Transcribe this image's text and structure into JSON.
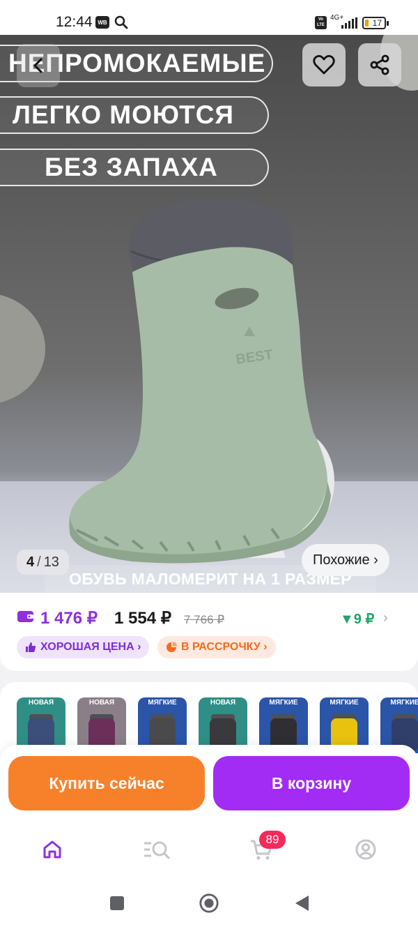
{
  "status_bar": {
    "time": "12:44",
    "wb_badge": "WB",
    "volte": "Vo LTE",
    "network": "4G+",
    "battery": "17"
  },
  "gallery": {
    "promo_lines": [
      "НЕПРОМОКАЕМЫЕ",
      "ЛЕГКО МОЮТСЯ",
      "БЕЗ ЗАПАХА"
    ],
    "bottom_caption": "ОБУВЬ МАЛОМЕРИТ НА 1 РАЗМЕР",
    "boot_brand": "BEST",
    "current_index": "4",
    "separator": "/",
    "total": "13",
    "similar_label": "Похожие ›"
  },
  "price": {
    "wallet_price": "1 476 ₽",
    "main_price": "1 554 ₽",
    "old_price": "7 766 ₽",
    "cashback": "▼9 ₽",
    "cashback_chevron": "›",
    "badges": [
      {
        "label": "ХОРОШАЯ ЦЕНА ›"
      },
      {
        "label": "В РАССРОЧКУ ›"
      }
    ]
  },
  "variants": [
    {
      "label": "НОВАЯ",
      "bg": "#2f8f86",
      "boot": "#3b4f7a"
    },
    {
      "label": "НОВАЯ",
      "bg": "#8a7f88",
      "boot": "#6b2f5a"
    },
    {
      "label": "МЯГКИЕ",
      "bg": "#2a55a8",
      "boot": "#4a4a4d"
    },
    {
      "label": "НОВАЯ",
      "bg": "#2f8f86",
      "boot": "#3a3a3d"
    },
    {
      "label": "МЯГКИЕ",
      "bg": "#2a55a8",
      "boot": "#2f2f33"
    },
    {
      "label": "МЯГКИЕ",
      "bg": "#2a55a8",
      "boot": "#e8c20f"
    },
    {
      "label": "МЯГКИЕ",
      "bg": "#2a55a8",
      "boot": "#2f3f6a"
    }
  ],
  "actions": {
    "buy_now": "Купить сейчас",
    "add_to_cart": "В корзину"
  },
  "bottom_nav": {
    "cart_count": "89"
  },
  "colors": {
    "accent_purple": "#a22cf4",
    "accent_orange": "#f7812b",
    "price_purple": "#8e2fe0",
    "cashback_green": "#1ea56a",
    "badge_red": "#f5295a"
  }
}
